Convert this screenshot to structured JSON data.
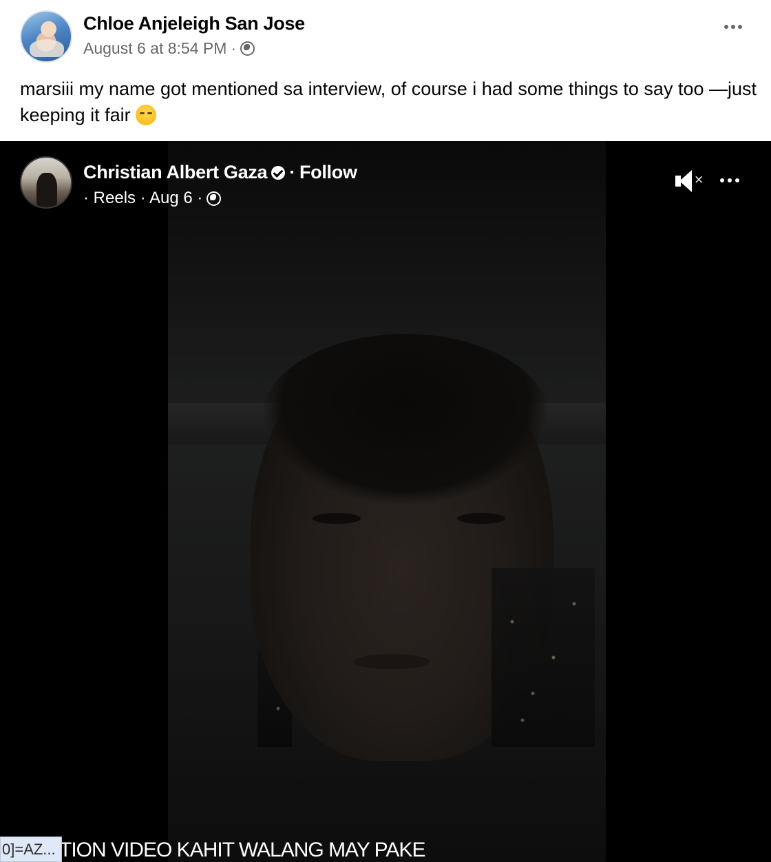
{
  "post": {
    "author_name": "Chloe Anjeleigh San Jose",
    "timestamp": "August 6 at 8:54 PM",
    "meta_separator": "·",
    "privacy_icon": "globe-icon",
    "caption_text": "marsiii my name got mentioned sa interview, of course i had some things to say too —just keeping it fair",
    "caption_emoji": "tired-face-emoji"
  },
  "reel": {
    "author_name": "Christian Albert Gaza",
    "verified_icon": "verified-badge-icon",
    "follow_separator": "·",
    "follow_label": "Follow",
    "meta_text": "· Reels · Aug 6 ·",
    "privacy_icon": "globe-icon",
    "mute_icon": "speaker-muted-icon",
    "more_icon": "more-options-icon",
    "subtitle_text": "TION VIDEO KAHIT WALANG MAY PAKE",
    "url_tooltip": "0]=AZ..."
  },
  "colors": {
    "text_primary": "#050505",
    "text_secondary": "#65676b",
    "video_background": "#000000",
    "overlay_text": "#ffffff",
    "tooltip_background": "#dfe8f6"
  }
}
